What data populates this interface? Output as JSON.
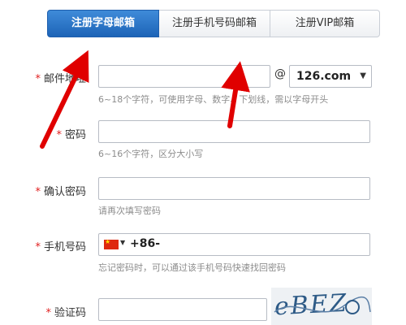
{
  "tabs": [
    {
      "label": "注册字母邮箱",
      "active": true
    },
    {
      "label": "注册手机号码邮箱",
      "active": false
    },
    {
      "label": "注册VIP邮箱",
      "active": false
    }
  ],
  "form": {
    "required_mark": "*",
    "email": {
      "label": "邮件地址",
      "value": "",
      "at": "@",
      "domain": "126.com",
      "hint": "6~18个字符，可使用字母、数字、下划线，需以字母开头"
    },
    "password": {
      "label": "密码",
      "value": "",
      "hint": "6~16个字符，区分大小写"
    },
    "confirm": {
      "label": "确认密码",
      "value": "",
      "hint": "请再次填写密码"
    },
    "phone": {
      "label": "手机号码",
      "prefix": "+86-",
      "hint": "忘记密码时，可以通过该手机号码快速找回密码"
    },
    "captcha": {
      "label": "验证码",
      "value": "",
      "image_text": "eBEZ"
    }
  },
  "colors": {
    "active_tab": "#1d64b7",
    "required": "#e02020",
    "annotation_arrow": "#e00000"
  },
  "icons": [
    "china-flag-icon",
    "dropdown-caret-icon",
    "red-arrow-annotation"
  ]
}
